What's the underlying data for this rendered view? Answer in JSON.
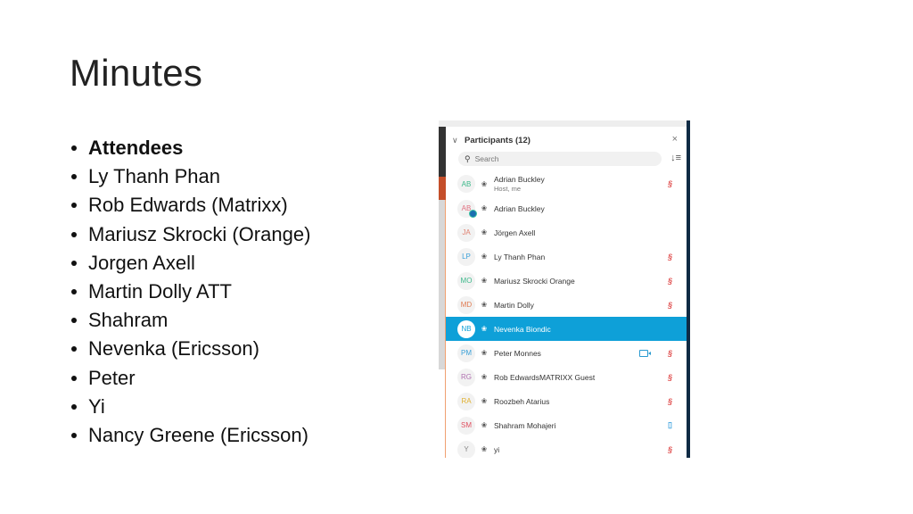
{
  "slide": {
    "title": "Minutes",
    "bullets": [
      "Attendees",
      "Ly Thanh Phan",
      "Rob Edwards (Matrixx)",
      "Mariusz Skrocki (Orange)",
      "Jorgen Axell",
      "Martin Dolly ATT",
      "Shahram",
      "Nevenka (Ericsson)",
      "Peter",
      "Yi",
      "Nancy Greene (Ericsson)"
    ]
  },
  "participants_panel": {
    "title": "Participants (12)",
    "search_placeholder": "Search",
    "icons": {
      "collapse": "chevron-down-icon",
      "close": "close-icon",
      "search": "search-icon",
      "sort": "sort-icon",
      "headset": "headset-icon",
      "mic_muted": "mic-muted-icon",
      "mic_active": "mic-active-icon",
      "camera": "camera-icon"
    },
    "participants": [
      {
        "initials": "AB",
        "name": "Adrian Buckley",
        "subtitle": "Host, me",
        "avatar_color": "#3cb88a",
        "mic": "muted",
        "camera": false,
        "selected": false,
        "status_dot": false
      },
      {
        "initials": "AB",
        "name": "Adrian Buckley",
        "subtitle": "",
        "avatar_color": "#e07080",
        "mic": "none",
        "camera": false,
        "selected": false,
        "status_dot": true
      },
      {
        "initials": "JA",
        "name": "Jörgen Axell",
        "subtitle": "",
        "avatar_color": "#e08070",
        "mic": "none",
        "camera": false,
        "selected": false,
        "status_dot": false
      },
      {
        "initials": "LP",
        "name": "Ly Thanh Phan",
        "subtitle": "",
        "avatar_color": "#3aa0d8",
        "mic": "muted",
        "camera": false,
        "selected": false,
        "status_dot": false
      },
      {
        "initials": "MO",
        "name": "Mariusz Skrocki Orange",
        "subtitle": "",
        "avatar_color": "#3cb88a",
        "mic": "muted",
        "camera": false,
        "selected": false,
        "status_dot": false
      },
      {
        "initials": "MD",
        "name": "Martin Dolly",
        "subtitle": "",
        "avatar_color": "#e07a50",
        "mic": "muted",
        "camera": false,
        "selected": false,
        "status_dot": false
      },
      {
        "initials": "NB",
        "name": "Nevenka Biondic",
        "subtitle": "",
        "avatar_color": "#0ea0d8",
        "mic": "none",
        "camera": false,
        "selected": true,
        "status_dot": false
      },
      {
        "initials": "PM",
        "name": "Peter Monnes",
        "subtitle": "",
        "avatar_color": "#3aa0d8",
        "mic": "muted",
        "camera": true,
        "selected": false,
        "status_dot": false
      },
      {
        "initials": "RG",
        "name": "Rob EdwardsMATRIXX Guest",
        "subtitle": "",
        "avatar_color": "#b070b0",
        "mic": "muted",
        "camera": false,
        "selected": false,
        "status_dot": false
      },
      {
        "initials": "RA",
        "name": "Roozbeh Atarius",
        "subtitle": "",
        "avatar_color": "#e0b030",
        "mic": "muted",
        "camera": false,
        "selected": false,
        "status_dot": false
      },
      {
        "initials": "SM",
        "name": "Shahram Mohajeri",
        "subtitle": "",
        "avatar_color": "#e05060",
        "mic": "active",
        "camera": false,
        "selected": false,
        "status_dot": false
      },
      {
        "initials": "Y",
        "name": "yi",
        "subtitle": "",
        "avatar_color": "#888888",
        "mic": "muted",
        "camera": false,
        "selected": false,
        "status_dot": false
      }
    ]
  }
}
